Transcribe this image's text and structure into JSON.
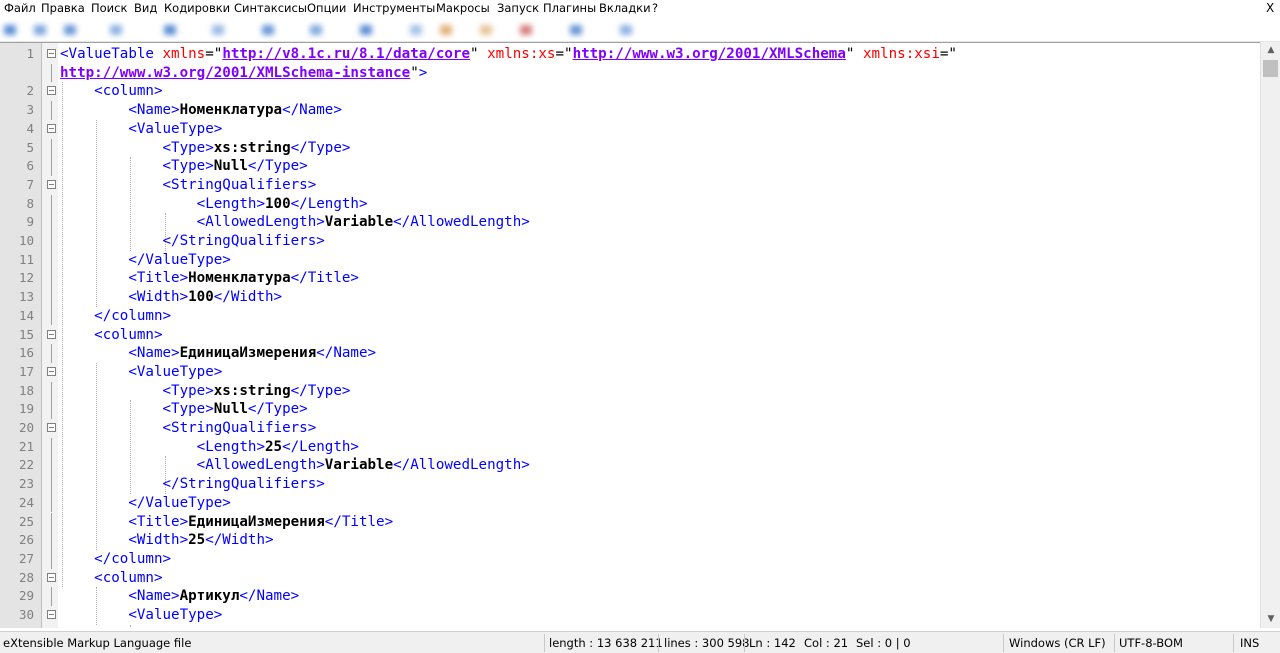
{
  "menu": {
    "items": [
      "Файл",
      "Правка",
      "Поиск",
      "Вид",
      "Кодировки",
      "Синтаксисы",
      "Опции",
      "Инструменты",
      "Макросы",
      "Запуск",
      "Плагины",
      "Вкладки",
      "?"
    ],
    "close": "X"
  },
  "colors": {
    "tag": "#0000ff",
    "attribute": "#ff0000",
    "attribute_value": "#8000ff",
    "text": "#000000",
    "line_number": "#808080"
  },
  "editor": {
    "lines": [
      {
        "n": "1",
        "parts": [
          [
            "tag",
            "<ValueTable "
          ],
          [
            "attr",
            "xmlns"
          ],
          [
            "eq",
            "=\""
          ],
          [
            "str",
            "http://v8.1c.ru/8.1/data/core"
          ],
          [
            "eq",
            "\" "
          ],
          [
            "attr",
            "xmlns:xs"
          ],
          [
            "eq",
            "=\""
          ],
          [
            "str",
            "http://www.w3.org/2001/XMLSchema"
          ],
          [
            "eq",
            "\" "
          ],
          [
            "attr",
            "xmlns:xsi"
          ],
          [
            "eq",
            "=\""
          ]
        ]
      },
      {
        "n": "",
        "parts": [
          [
            "str",
            "http://www.w3.org/2001/XMLSchema-instance"
          ],
          [
            "eq",
            "\""
          ],
          [
            "tag",
            ">"
          ]
        ]
      },
      {
        "n": "2",
        "parts": [
          [
            "tag",
            "    <column>"
          ]
        ]
      },
      {
        "n": "3",
        "parts": [
          [
            "tag",
            "        <Name>"
          ],
          [
            "txt",
            "Номенклатура"
          ],
          [
            "tag",
            "</Name>"
          ]
        ]
      },
      {
        "n": "4",
        "parts": [
          [
            "tag",
            "        <ValueType>"
          ]
        ]
      },
      {
        "n": "5",
        "parts": [
          [
            "tag",
            "            <Type>"
          ],
          [
            "txt",
            "xs:string"
          ],
          [
            "tag",
            "</Type>"
          ]
        ]
      },
      {
        "n": "6",
        "parts": [
          [
            "tag",
            "            <Type>"
          ],
          [
            "txt",
            "Null"
          ],
          [
            "tag",
            "</Type>"
          ]
        ]
      },
      {
        "n": "7",
        "parts": [
          [
            "tag",
            "            <StringQualifiers>"
          ]
        ]
      },
      {
        "n": "8",
        "parts": [
          [
            "tag",
            "                <Length>"
          ],
          [
            "txt",
            "100"
          ],
          [
            "tag",
            "</Length>"
          ]
        ]
      },
      {
        "n": "9",
        "parts": [
          [
            "tag",
            "                <AllowedLength>"
          ],
          [
            "txt",
            "Variable"
          ],
          [
            "tag",
            "</AllowedLength>"
          ]
        ]
      },
      {
        "n": "10",
        "parts": [
          [
            "tag",
            "            </StringQualifiers>"
          ]
        ]
      },
      {
        "n": "11",
        "parts": [
          [
            "tag",
            "        </ValueType>"
          ]
        ]
      },
      {
        "n": "12",
        "parts": [
          [
            "tag",
            "        <Title>"
          ],
          [
            "txt",
            "Номенклатура"
          ],
          [
            "tag",
            "</Title>"
          ]
        ]
      },
      {
        "n": "13",
        "parts": [
          [
            "tag",
            "        <Width>"
          ],
          [
            "txt",
            "100"
          ],
          [
            "tag",
            "</Width>"
          ]
        ]
      },
      {
        "n": "14",
        "parts": [
          [
            "tag",
            "    </column>"
          ]
        ]
      },
      {
        "n": "15",
        "parts": [
          [
            "tag",
            "    <column>"
          ]
        ]
      },
      {
        "n": "16",
        "parts": [
          [
            "tag",
            "        <Name>"
          ],
          [
            "txt",
            "ЕдиницаИзмерения"
          ],
          [
            "tag",
            "</Name>"
          ]
        ]
      },
      {
        "n": "17",
        "parts": [
          [
            "tag",
            "        <ValueType>"
          ]
        ]
      },
      {
        "n": "18",
        "parts": [
          [
            "tag",
            "            <Type>"
          ],
          [
            "txt",
            "xs:string"
          ],
          [
            "tag",
            "</Type>"
          ]
        ]
      },
      {
        "n": "19",
        "parts": [
          [
            "tag",
            "            <Type>"
          ],
          [
            "txt",
            "Null"
          ],
          [
            "tag",
            "</Type>"
          ]
        ]
      },
      {
        "n": "20",
        "parts": [
          [
            "tag",
            "            <StringQualifiers>"
          ]
        ]
      },
      {
        "n": "21",
        "parts": [
          [
            "tag",
            "                <Length>"
          ],
          [
            "txt",
            "25"
          ],
          [
            "tag",
            "</Length>"
          ]
        ]
      },
      {
        "n": "22",
        "parts": [
          [
            "tag",
            "                <AllowedLength>"
          ],
          [
            "txt",
            "Variable"
          ],
          [
            "tag",
            "</AllowedLength>"
          ]
        ]
      },
      {
        "n": "23",
        "parts": [
          [
            "tag",
            "            </StringQualifiers>"
          ]
        ]
      },
      {
        "n": "24",
        "parts": [
          [
            "tag",
            "        </ValueType>"
          ]
        ]
      },
      {
        "n": "25",
        "parts": [
          [
            "tag",
            "        <Title>"
          ],
          [
            "txt",
            "ЕдиницаИзмерения"
          ],
          [
            "tag",
            "</Title>"
          ]
        ]
      },
      {
        "n": "26",
        "parts": [
          [
            "tag",
            "        <Width>"
          ],
          [
            "txt",
            "25"
          ],
          [
            "tag",
            "</Width>"
          ]
        ]
      },
      {
        "n": "27",
        "parts": [
          [
            "tag",
            "    </column>"
          ]
        ]
      },
      {
        "n": "28",
        "parts": [
          [
            "tag",
            "    <column>"
          ]
        ]
      },
      {
        "n": "29",
        "parts": [
          [
            "tag",
            "        <Name>"
          ],
          [
            "txt",
            "Артикул"
          ],
          [
            "tag",
            "</Name>"
          ]
        ]
      },
      {
        "n": "30",
        "parts": [
          [
            "tag",
            "        <ValueType>"
          ]
        ]
      }
    ]
  },
  "status": {
    "file_type": "eXtensible Markup Language file",
    "length": "length : 13 638 211",
    "lines": "lines : 300 598",
    "ln": "Ln : 142",
    "col": "Col : 21",
    "sel": "Sel : 0 | 0",
    "eol": "Windows (CR LF)",
    "encoding": "UTF-8-BOM",
    "mode": "INS"
  }
}
